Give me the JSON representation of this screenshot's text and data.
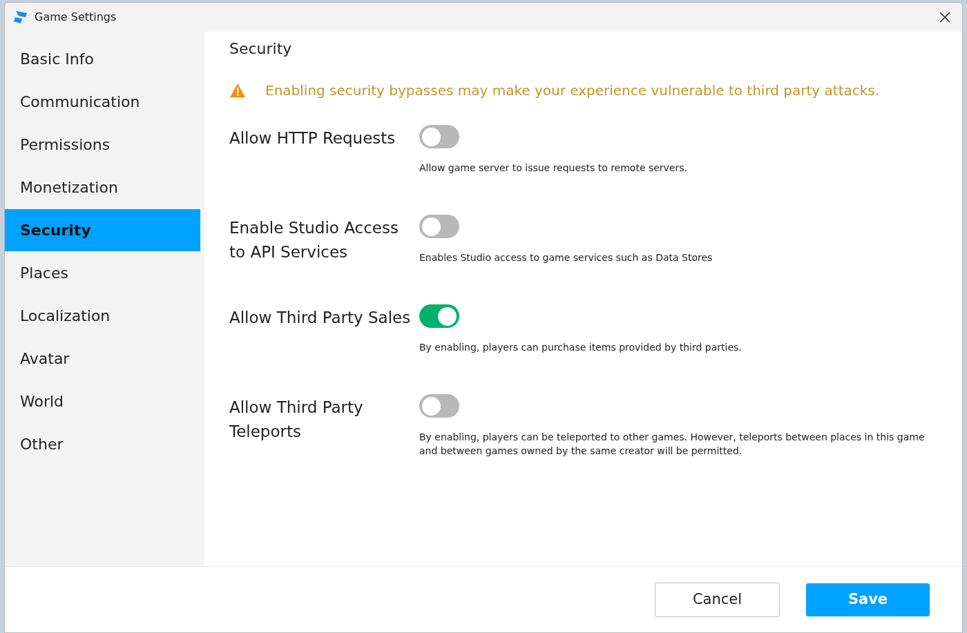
{
  "window": {
    "title": "Game Settings"
  },
  "sidebar": {
    "items": [
      {
        "label": "Basic Info",
        "selected": false
      },
      {
        "label": "Communication",
        "selected": false
      },
      {
        "label": "Permissions",
        "selected": false
      },
      {
        "label": "Monetization",
        "selected": false
      },
      {
        "label": "Security",
        "selected": true
      },
      {
        "label": "Places",
        "selected": false
      },
      {
        "label": "Localization",
        "selected": false
      },
      {
        "label": "Avatar",
        "selected": false
      },
      {
        "label": "World",
        "selected": false
      },
      {
        "label": "Other",
        "selected": false
      }
    ]
  },
  "content": {
    "heading": "Security",
    "warning": "Enabling security bypasses may make your experience vulnerable to third party attacks.",
    "settings": [
      {
        "label": "Allow HTTP Requests",
        "on": false,
        "description": "Allow game server to issue requests to remote servers."
      },
      {
        "label": "Enable Studio Access to API Services",
        "on": false,
        "description": "Enables Studio access to game services such as Data Stores"
      },
      {
        "label": "Allow Third Party Sales",
        "on": true,
        "description": "By enabling, players can purchase items provided by third parties."
      },
      {
        "label": "Allow Third Party Teleports",
        "on": false,
        "description": "By enabling, players can be teleported to other games. However, teleports between places in this game and between games owned by the same creator will be permitted."
      }
    ]
  },
  "buttons": {
    "cancel": "Cancel",
    "save": "Save"
  }
}
